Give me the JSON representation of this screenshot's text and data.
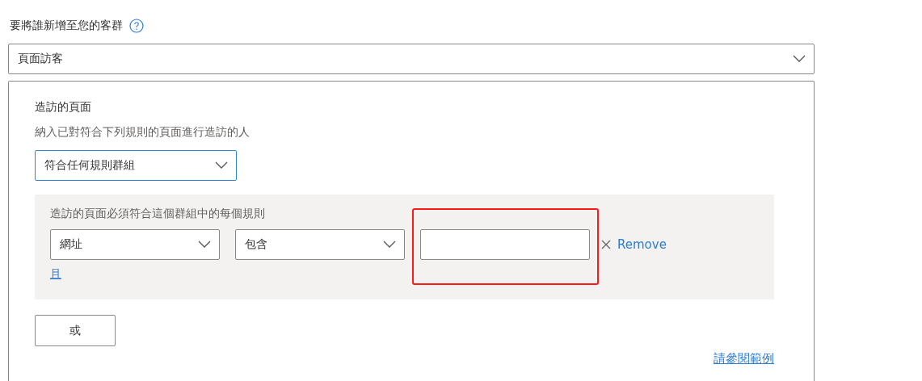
{
  "audience": {
    "label": "要將誰新增至您的客群",
    "dropdown": {
      "value": "頁面訪客"
    }
  },
  "panel": {
    "title": "造訪的頁面",
    "description": "納入已對符合下列規則的頁面進行造訪的人",
    "match_dropdown": {
      "value": "符合任何規則群組",
      "focused": true
    },
    "rule_group": {
      "label": "造訪的頁面必須符合這個群組中的每個規則",
      "rules": [
        {
          "field": "網址",
          "operator": "包含",
          "highlighted": true,
          "remove_label": "Remove"
        }
      ],
      "and_link": "且"
    },
    "or_button": "或",
    "examples_link": "請參閱範例"
  }
}
